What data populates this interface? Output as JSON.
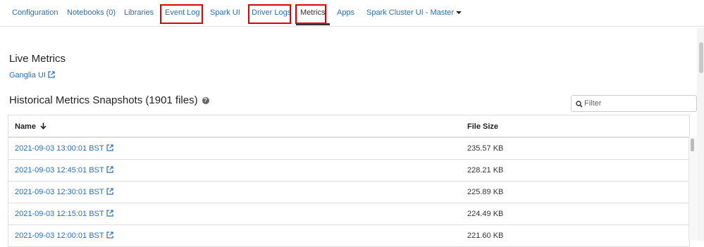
{
  "nav": {
    "tabs": [
      {
        "label": "Configuration"
      },
      {
        "label": "Notebooks (0)"
      },
      {
        "label": "Libraries"
      },
      {
        "label": "Event Log"
      },
      {
        "label": "Spark UI"
      },
      {
        "label": "Driver Logs"
      },
      {
        "label": "Metrics"
      },
      {
        "label": "Apps"
      },
      {
        "label": "Spark Cluster UI - Master"
      }
    ],
    "active_tab": "Metrics",
    "highlight_color": "#e00000"
  },
  "live": {
    "heading": "Live Metrics",
    "ganglia_link": "Ganglia UI"
  },
  "historical": {
    "heading": "Historical Metrics Snapshots (1901 files)",
    "help_glyph": "?"
  },
  "filter": {
    "placeholder": "Filter",
    "value": ""
  },
  "table": {
    "headers": {
      "name": "Name",
      "size": "File Size"
    },
    "rows": [
      {
        "name": "2021-09-03 13:00:01 BST",
        "size": "235.57 KB"
      },
      {
        "name": "2021-09-03 12:45:01 BST",
        "size": "228.21 KB"
      },
      {
        "name": "2021-09-03 12:30:01 BST",
        "size": "225.89 KB"
      },
      {
        "name": "2021-09-03 12:15:01 BST",
        "size": "224.49 KB"
      },
      {
        "name": "2021-09-03 12:00:01 BST",
        "size": "221.60 KB"
      }
    ]
  },
  "colors": {
    "link": "#2a6fb0",
    "text": "#333333"
  }
}
